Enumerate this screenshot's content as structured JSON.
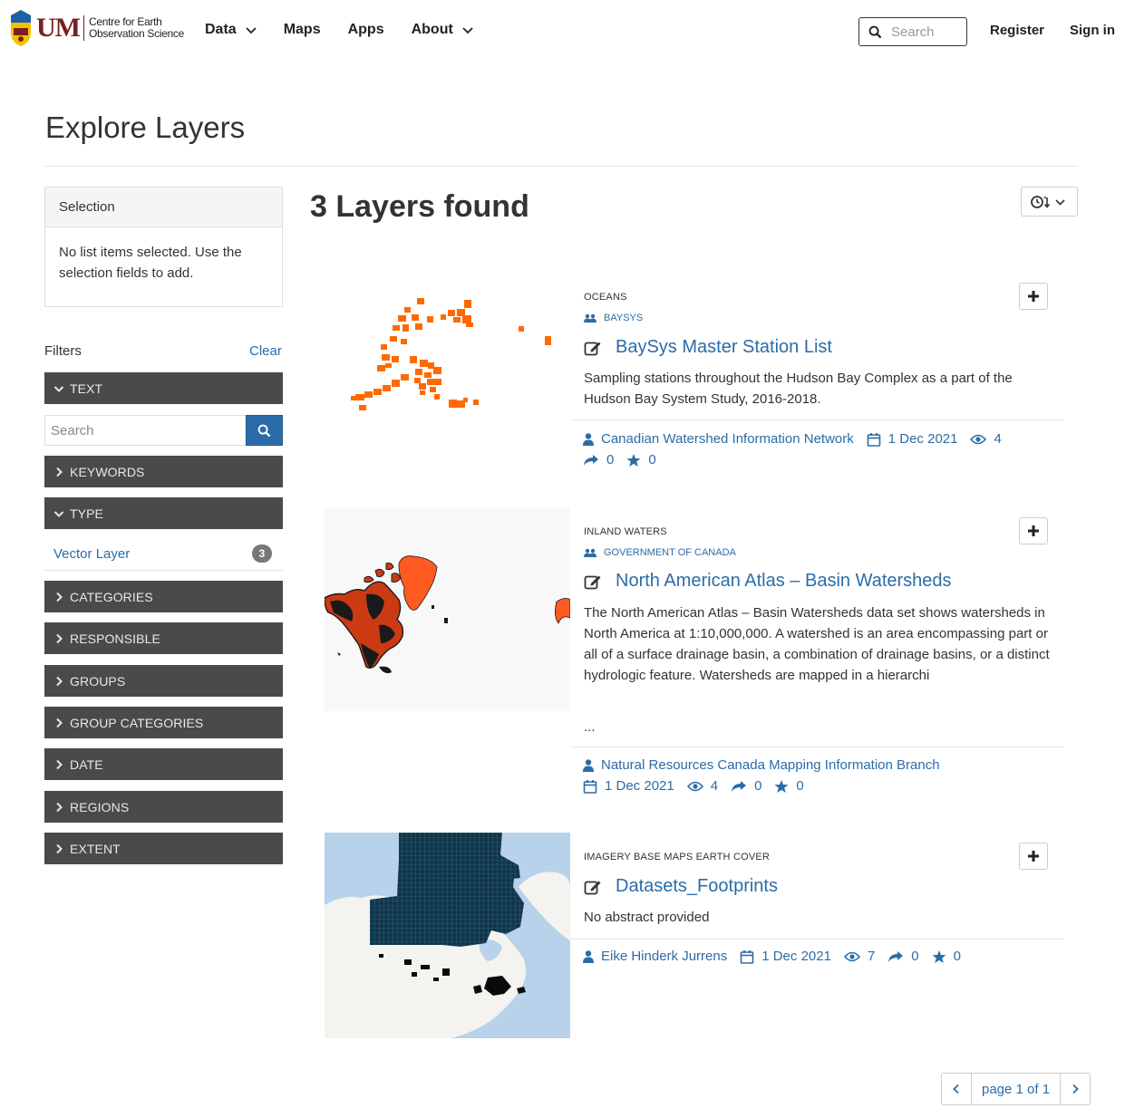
{
  "header": {
    "logo_um": "UM",
    "logo_line1": "Centre for Earth",
    "logo_line2": "Observation Science",
    "nav": [
      "Data",
      "Maps",
      "Apps",
      "About"
    ],
    "search_placeholder": "Search",
    "register": "Register",
    "sign_in": "Sign in"
  },
  "page": {
    "title": "Explore Layers",
    "results_title": "3 Layers found"
  },
  "sidebar": {
    "selection_title": "Selection",
    "selection_empty": "No list items selected. Use the selection fields to add.",
    "filters_label": "Filters",
    "clear_label": "Clear",
    "facets": [
      "TEXT",
      "KEYWORDS",
      "TYPE",
      "CATEGORIES",
      "RESPONSIBLE",
      "GROUPS",
      "GROUP CATEGORIES",
      "DATE",
      "REGIONS",
      "EXTENT"
    ],
    "text_search_placeholder": "Search",
    "type_item_label": "Vector Layer",
    "type_item_count": "3"
  },
  "layers": [
    {
      "category": "OCEANS",
      "group": "BAYSYS",
      "title": "BaySys Master Station List",
      "abstract": "Sampling stations throughout the Hudson Bay Complex as a part of the Hudson Bay System Study, 2016-2018.",
      "owner": "Canadian Watershed Information Network",
      "date": "1 Dec 2021",
      "views": "4",
      "shares": "0",
      "rating": "0"
    },
    {
      "category": "INLAND WATERS",
      "group": "GOVERNMENT OF CANADA",
      "title": "North American Atlas – Basin Watersheds",
      "abstract": "The North American Atlas – Basin Watersheds data set shows watersheds in North America at 1:10,000,000.  A watershed is an area encompassing part or all of a surface drainage basin, a combination of drainage basins, or a distinct hydrologic feature. Watersheds are mapped in a hierarchi",
      "ellipsis": "...",
      "owner": "Natural Resources Canada Mapping Information Branch",
      "date": "1 Dec 2021",
      "views": "4",
      "shares": "0",
      "rating": "0"
    },
    {
      "category": "IMAGERY BASE MAPS EARTH COVER",
      "title": "Datasets_Footprints",
      "abstract": "No abstract provided",
      "owner": "Eike Hinderk Jurrens",
      "date": "1 Dec 2021",
      "views": "7",
      "shares": "0",
      "rating": "0"
    }
  ],
  "pager": {
    "label": "page 1 of 1"
  }
}
